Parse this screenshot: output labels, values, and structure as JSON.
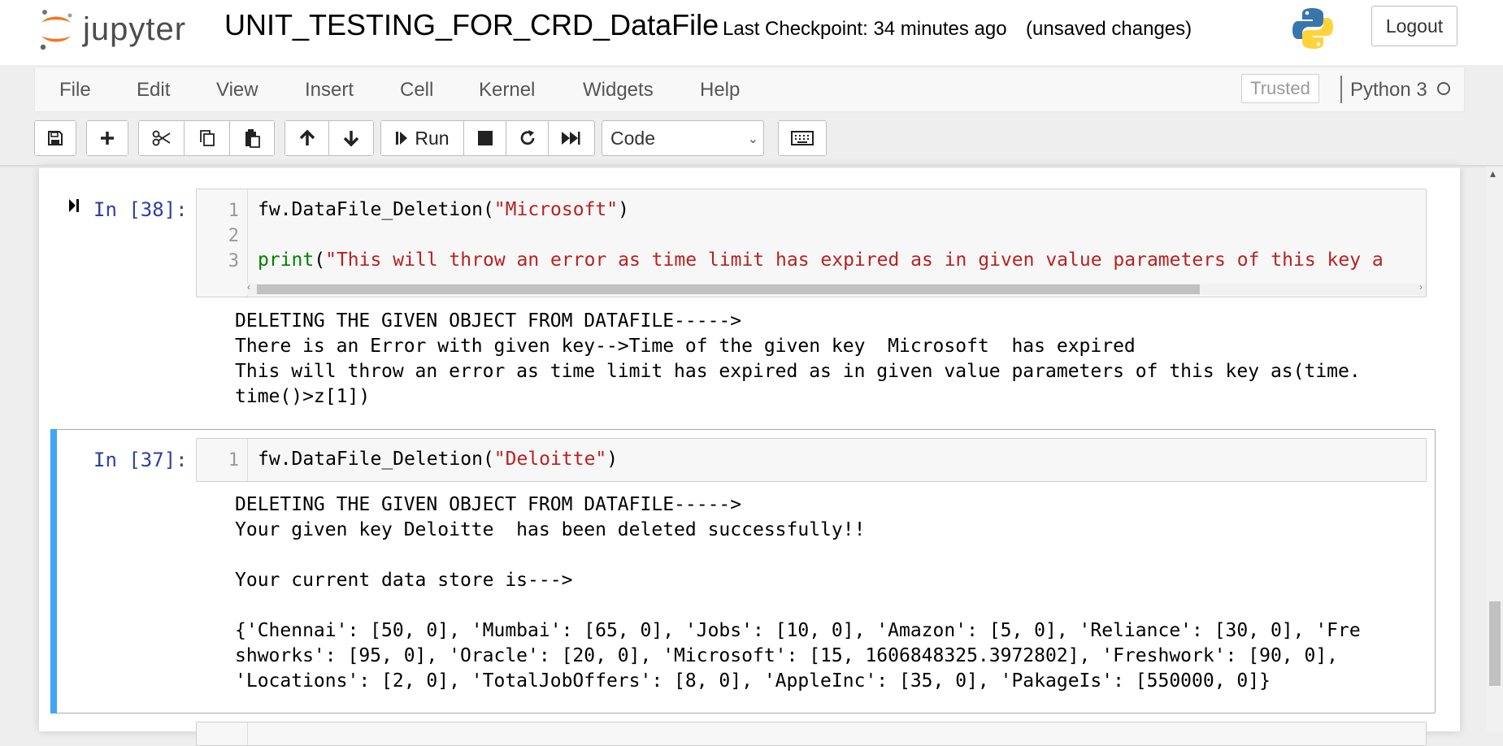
{
  "header": {
    "logo_text": "jupyter",
    "notebook_title": "UNIT_TESTING_FOR_CRD_DataFile",
    "checkpoint": "Last Checkpoint: 34 minutes ago",
    "save_status": "(unsaved changes)",
    "logout_label": "Logout"
  },
  "menubar": {
    "items": [
      "File",
      "Edit",
      "View",
      "Insert",
      "Cell",
      "Kernel",
      "Widgets",
      "Help"
    ],
    "trusted_label": "Trusted",
    "kernel_name": "Python 3"
  },
  "toolbar": {
    "run_label": "Run",
    "cell_type": "Code",
    "icons": [
      "save-icon",
      "plus-icon",
      "cut-icon",
      "copy-icon",
      "paste-icon",
      "arrow-up-icon",
      "arrow-down-icon",
      "step-forward-icon",
      "stop-icon",
      "restart-icon",
      "fast-forward-icon",
      "keyboard-icon"
    ]
  },
  "cells": [
    {
      "prompt": "In [38]:",
      "line_numbers": [
        "1",
        "2",
        "3"
      ],
      "code": {
        "line1_prefix": "fw.DataFile_Deletion(",
        "line1_string": "\"Microsoft\"",
        "line1_suffix": ")",
        "line3_keyword": "print",
        "line3_paren": "(",
        "line3_string": "\"This will throw an error as time limit has expired as in given value parameters of this key a"
      },
      "output": [
        "DELETING THE GIVEN OBJECT FROM DATAFILE----->",
        "There is an Error with given key-->Time of the given key  Microsoft  has expired",
        "This will throw an error as time limit has expired as in given value parameters of this key as(time.",
        "time()>z[1])"
      ]
    },
    {
      "prompt": "In [37]:",
      "line_numbers": [
        "1"
      ],
      "code": {
        "line1_prefix": "fw.DataFile_Deletion(",
        "line1_string": "\"Deloitte\"",
        "line1_suffix": ")"
      },
      "output": [
        "DELETING THE GIVEN OBJECT FROM DATAFILE----->",
        "Your given key Deloitte  has been deleted successfully!!",
        "",
        "Your current data store is--->",
        "",
        "{'Chennai': [50, 0], 'Mumbai': [65, 0], 'Jobs': [10, 0], 'Amazon': [5, 0], 'Reliance': [30, 0], 'Fre",
        "shworks': [95, 0], 'Oracle': [20, 0], 'Microsoft': [15, 1606848325.3972802], 'Freshwork': [90, 0],",
        "'Locations': [2, 0], 'TotalJobOffers': [8, 0], 'AppleInc': [35, 0], 'PakageIs': [550000, 0]}"
      ]
    }
  ],
  "colors": {
    "prompt": "#303f9f",
    "string": "#ba2121",
    "keyword": "#008000",
    "selected_cell_bar": "#42a5f5",
    "logo_orange": "#f37726"
  }
}
